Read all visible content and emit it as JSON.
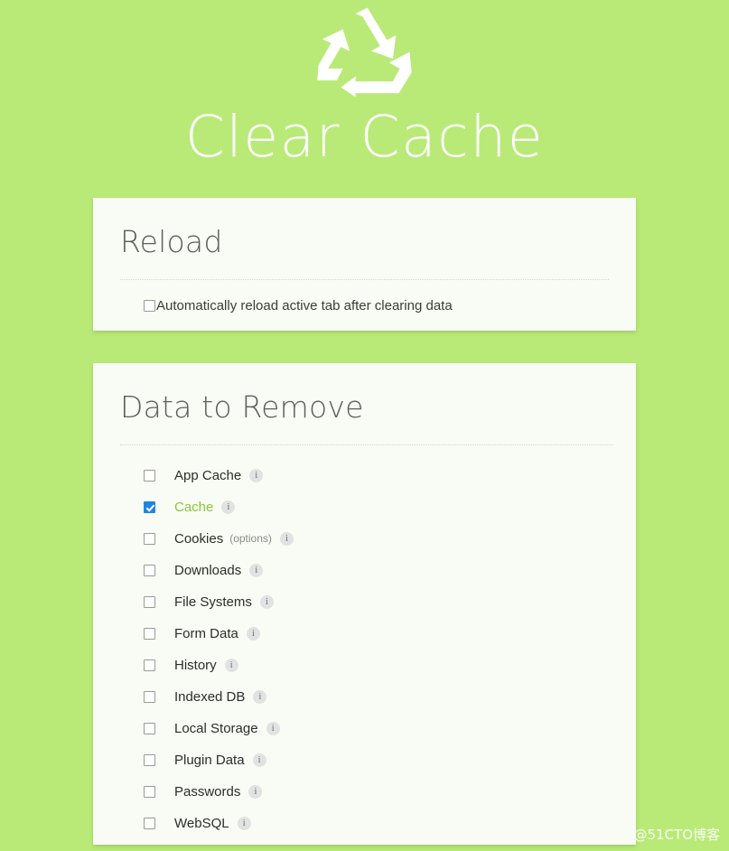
{
  "header": {
    "logo_icon": "recycle-icon",
    "title": "Clear Cache"
  },
  "reload_card": {
    "title": "Reload",
    "checkbox": {
      "label": "Automatically reload active tab after clearing data",
      "checked": false
    }
  },
  "data_card": {
    "title": "Data to Remove",
    "items": [
      {
        "label": "App Cache",
        "checked": false,
        "info": "i"
      },
      {
        "label": "Cache",
        "checked": true,
        "info": "i"
      },
      {
        "label": "Cookies",
        "checked": false,
        "info": "i",
        "options_label": "(options)"
      },
      {
        "label": "Downloads",
        "checked": false,
        "info": "i"
      },
      {
        "label": "File Systems",
        "checked": false,
        "info": "i"
      },
      {
        "label": "Form Data",
        "checked": false,
        "info": "i"
      },
      {
        "label": "History",
        "checked": false,
        "info": "i"
      },
      {
        "label": "Indexed DB",
        "checked": false,
        "info": "i"
      },
      {
        "label": "Local Storage",
        "checked": false,
        "info": "i"
      },
      {
        "label": "Plugin Data",
        "checked": false,
        "info": "i"
      },
      {
        "label": "Passwords",
        "checked": false,
        "info": "i"
      },
      {
        "label": "WebSQL",
        "checked": false,
        "info": "i"
      }
    ]
  },
  "watermark": "@51CTO博客",
  "colors": {
    "background": "#b9ea78",
    "card": "#f8fcf4",
    "title": "#ffffff",
    "selected_label": "#8cc63e",
    "checkbox_checked": "#2084e4"
  }
}
